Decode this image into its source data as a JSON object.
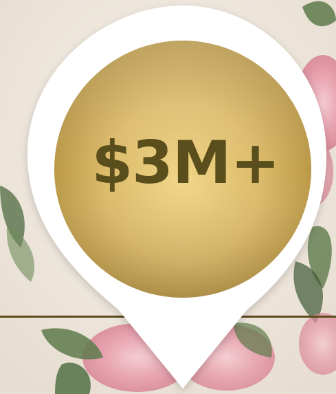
{
  "stat": {
    "value": "$3M+"
  },
  "colors": {
    "background": "#efe9df",
    "pin": "#ffffff",
    "gold_light": "#f1d688",
    "gold_dark": "#b2903f",
    "text": "#5a4e1c",
    "divider": "#5b4a1e",
    "rose": "#e9a8b4",
    "leaf": "#5e7a4c"
  },
  "icons": {
    "marker": "map-pin-icon",
    "decoration": "rose-floral-background"
  }
}
